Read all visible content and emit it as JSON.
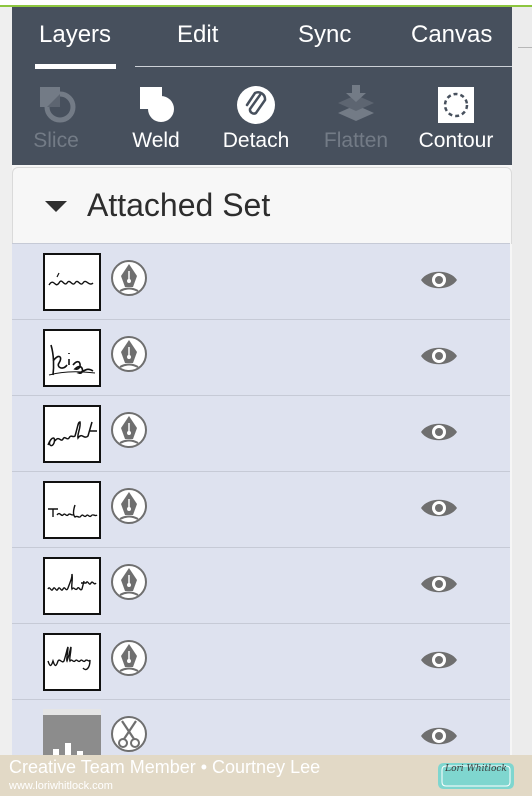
{
  "tabs": [
    "Layers",
    "Edit",
    "Sync",
    "Canvas"
  ],
  "active_tab": "Layers",
  "toolbar": [
    {
      "label": "Slice",
      "icon": "slice-icon",
      "enabled": false
    },
    {
      "label": "Weld",
      "icon": "weld-icon",
      "enabled": true
    },
    {
      "label": "Detach",
      "icon": "detach-icon",
      "enabled": true
    },
    {
      "label": "Flatten",
      "icon": "flatten-icon",
      "enabled": false
    },
    {
      "label": "Contour",
      "icon": "contour-icon",
      "enabled": true
    }
  ],
  "group": {
    "title": "Attached Set",
    "expanded": true
  },
  "layers": [
    {
      "thumb_text": "forever",
      "operation": "write-pen-icon",
      "visible": true
    },
    {
      "thumb_text": "kiss",
      "operation": "write-pen-icon",
      "visible": true
    },
    {
      "thumb_text": "perfect",
      "operation": "write-pen-icon",
      "visible": true
    },
    {
      "thumb_text": "true love",
      "operation": "write-pen-icon",
      "visible": true
    },
    {
      "thumb_text": "moments",
      "operation": "write-pen-icon",
      "visible": true
    },
    {
      "thumb_text": "wedding",
      "operation": "write-pen-icon",
      "visible": true
    },
    {
      "thumb_text": "",
      "operation": "cut-scissors-icon",
      "visible": true
    }
  ],
  "footer": {
    "line1": "Creative Team Member • Courtney Lee",
    "line2": "www.loriwhitlock.com",
    "badge": "Lori Whitlock"
  },
  "colors": {
    "topbar": "#47505d",
    "row": "#dee2ef",
    "accent_green": "#8dc63f",
    "footer": "#e2d9c6",
    "badge": "#7fd6cf"
  }
}
